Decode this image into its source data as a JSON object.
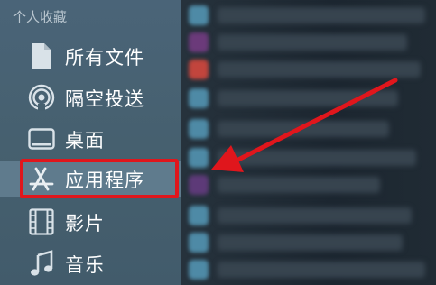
{
  "sidebar": {
    "section_title": "个人收藏",
    "items": [
      {
        "label": "所有文件",
        "icon": "document-icon"
      },
      {
        "label": "隔空投送",
        "icon": "airdrop-icon"
      },
      {
        "label": "桌面",
        "icon": "desktop-icon"
      },
      {
        "label": "应用程序",
        "icon": "applications-icon",
        "selected": true
      },
      {
        "label": "影片",
        "icon": "film-icon"
      },
      {
        "label": "音乐",
        "icon": "music-note-icon"
      }
    ]
  },
  "annotation": {
    "highlight_color": "#e0161c",
    "arrow_color": "#e0161c"
  }
}
